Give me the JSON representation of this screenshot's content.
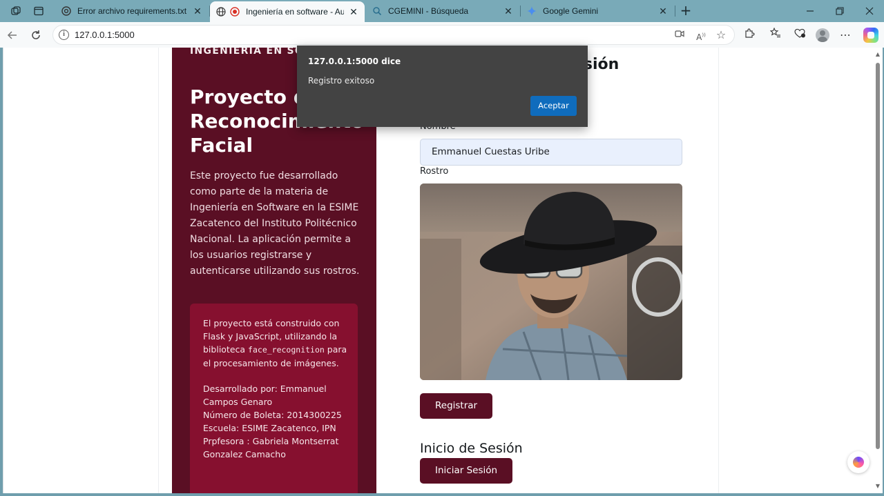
{
  "browser": {
    "tabs": [
      {
        "title": "Error archivo requirements.txt",
        "icon": "chatgpt-icon"
      },
      {
        "title": "Ingeniería en software - Auter",
        "icon": "recording-icon"
      },
      {
        "title": "CGEMINI - Búsqueda",
        "icon": "search-icon"
      },
      {
        "title": "Google Gemini",
        "icon": "gemini-icon"
      }
    ],
    "url": "127.0.0.1:5000"
  },
  "page": {
    "school_header": "INGENIERÍA EN SO",
    "project_title": "Proyecto de Reconocimiento Facial",
    "project_description": "Este proyecto fue desarrollado como parte de la materia de Ingeniería en Software en la ESIME Zacatenco del Instituto Politécnico Nacional. La aplicación permite a los usuarios registrarse y autenticarse utilizando sus rostros.",
    "info": {
      "built_prefix": "El proyecto está construido con Flask y JavaScript, utilizando la biblioteca ",
      "library": "face_recognition",
      "built_suffix": " para el procesamiento de imágenes.",
      "developer": "Desarrollado por: Emmanuel Campos Genaro",
      "boleta": "Número de Boleta: 2014300225",
      "school": "Escuela: ESIME Zacatenco, IPN",
      "professor": "Prpfesora : Gabriela Montserrat Gonzalez Camacho"
    },
    "login_heading_partial": "esión",
    "form": {
      "name_label": "Nombre",
      "name_value": "Emmanuel Cuestas Uribe",
      "face_label": "Rostro",
      "register_button": "Registrar"
    },
    "login_section": {
      "heading": "Inicio de Sesión",
      "button": "Iniciar Sesión"
    }
  },
  "dialog": {
    "title": "127.0.0.1:5000 dice",
    "message": "Registro exitoso",
    "ok_button": "Aceptar"
  },
  "colors": {
    "brand": "#5a0f24",
    "brand_light": "#86102f",
    "dialog_bg": "#434343",
    "dialog_button": "#0f6cbd",
    "browser_frame": "#79aab8"
  }
}
